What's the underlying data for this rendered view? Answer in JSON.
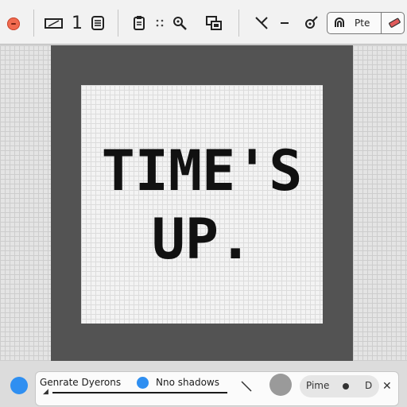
{
  "toolbar": {
    "close_icon": "close-icon",
    "number_label": "1",
    "pte_label": "Pte",
    "colors": {
      "close": "#f06a4f"
    }
  },
  "canvas": {
    "artwork_text_line1": "TIME'S",
    "artwork_text_line2": "UP."
  },
  "bottom_panel": {
    "generate_label": "Genrate Dyerons",
    "shadow_label": "Nno shadows",
    "pill_label": "Pime",
    "pill_value": "D",
    "accent_color": "#2f8ff1"
  }
}
